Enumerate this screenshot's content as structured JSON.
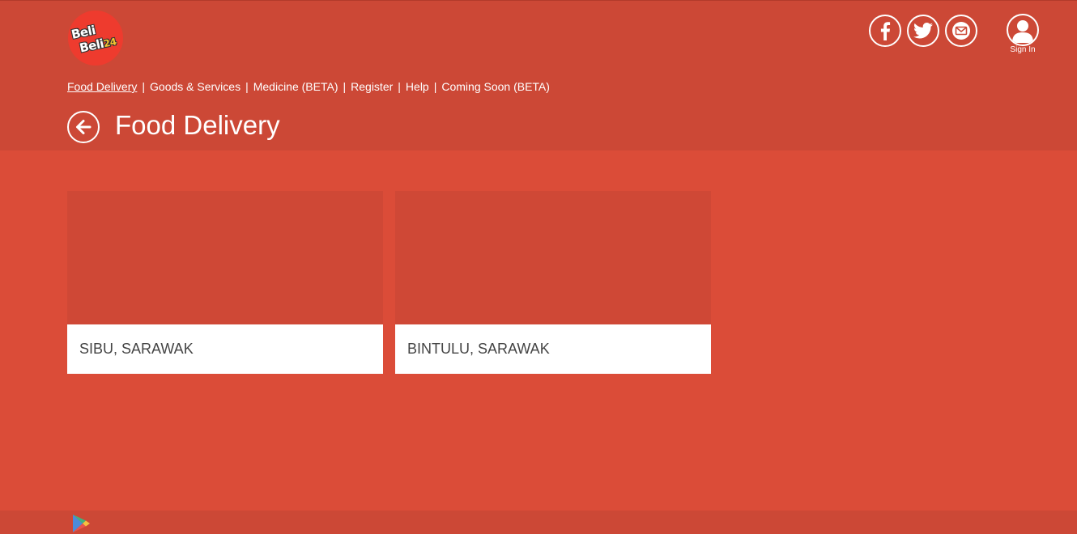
{
  "logo": {
    "line1": "Beli",
    "line2": "Beli",
    "number": "24"
  },
  "header": {
    "social_icons": [
      "facebook-icon",
      "twitter-icon",
      "mail-icon"
    ],
    "signin_icon": "user-icon",
    "signin_label": "Sign In"
  },
  "nav": {
    "items": [
      {
        "label": "Food Delivery",
        "active": true
      },
      {
        "label": "Goods & Services"
      },
      {
        "label": "Medicine (BETA)"
      },
      {
        "label": "Register"
      },
      {
        "label": "Help"
      },
      {
        "label": "Coming Soon (BETA)"
      }
    ],
    "separator": "|"
  },
  "page": {
    "title": "Food Delivery",
    "back_icon": "arrow-left-icon"
  },
  "cards": [
    {
      "label": "SIBU, SARAWAK"
    },
    {
      "label": "BINTULU, SARAWAK"
    }
  ],
  "footer": {
    "icon": "google-play-icon"
  },
  "colors": {
    "background": "#db4c38",
    "header": "#cc4836",
    "card_image": "#cf4836",
    "card_label_bg": "#ffffff",
    "card_text": "#444444",
    "text": "#ffffff"
  }
}
